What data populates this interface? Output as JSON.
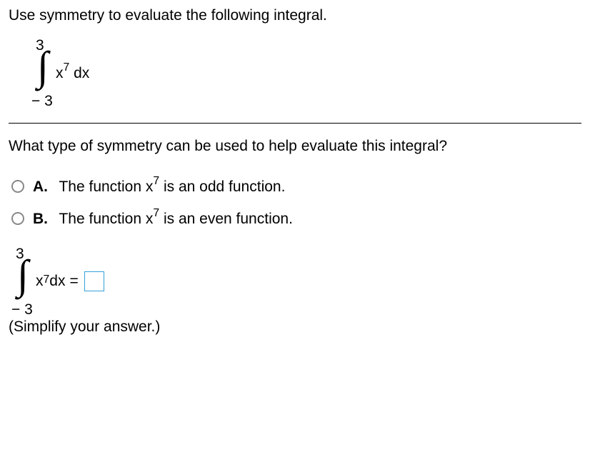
{
  "question": {
    "prompt": "Use symmetry to evaluate the following integral.",
    "integral": {
      "upper": "3",
      "lower": "− 3",
      "base": "x",
      "exponent": "7",
      "diff": " dx"
    }
  },
  "subquestion": "What type of symmetry can be used to help evaluate this integral?",
  "options": {
    "a": {
      "letter": "A.",
      "pre": "The function x",
      "exp": "7",
      "post": " is an odd function."
    },
    "b": {
      "letter": "B.",
      "pre": "The function x",
      "exp": "7",
      "post": " is an even function."
    }
  },
  "answer": {
    "integral": {
      "upper": "3",
      "lower": "− 3",
      "base": "x",
      "exponent": "7",
      "diff": " dx",
      "equals": "="
    },
    "hint": "(Simplify your answer.)"
  }
}
